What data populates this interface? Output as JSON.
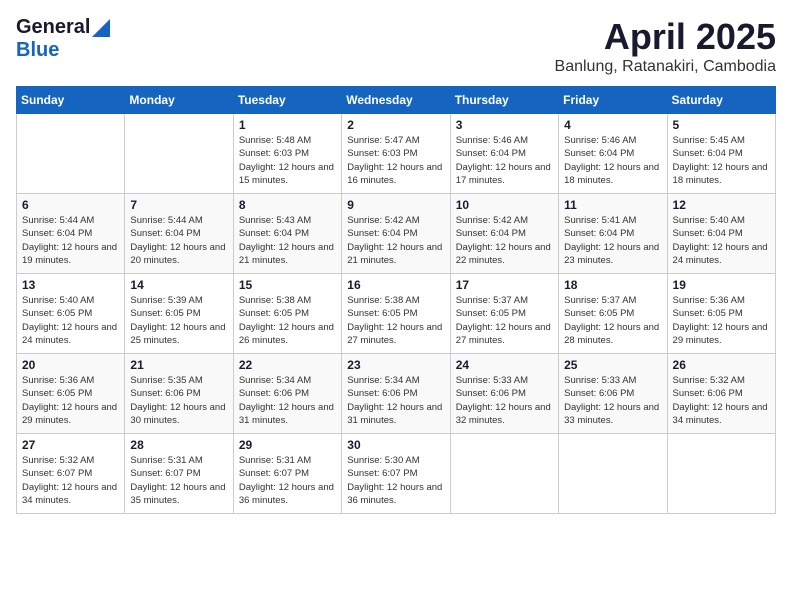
{
  "logo": {
    "general": "General",
    "blue": "Blue"
  },
  "title": {
    "month": "April 2025",
    "location": "Banlung, Ratanakiri, Cambodia"
  },
  "weekdays": [
    "Sunday",
    "Monday",
    "Tuesday",
    "Wednesday",
    "Thursday",
    "Friday",
    "Saturday"
  ],
  "weeks": [
    [
      {
        "day": "",
        "info": ""
      },
      {
        "day": "",
        "info": ""
      },
      {
        "day": "1",
        "info": "Sunrise: 5:48 AM\nSunset: 6:03 PM\nDaylight: 12 hours and 15 minutes."
      },
      {
        "day": "2",
        "info": "Sunrise: 5:47 AM\nSunset: 6:03 PM\nDaylight: 12 hours and 16 minutes."
      },
      {
        "day": "3",
        "info": "Sunrise: 5:46 AM\nSunset: 6:04 PM\nDaylight: 12 hours and 17 minutes."
      },
      {
        "day": "4",
        "info": "Sunrise: 5:46 AM\nSunset: 6:04 PM\nDaylight: 12 hours and 18 minutes."
      },
      {
        "day": "5",
        "info": "Sunrise: 5:45 AM\nSunset: 6:04 PM\nDaylight: 12 hours and 18 minutes."
      }
    ],
    [
      {
        "day": "6",
        "info": "Sunrise: 5:44 AM\nSunset: 6:04 PM\nDaylight: 12 hours and 19 minutes."
      },
      {
        "day": "7",
        "info": "Sunrise: 5:44 AM\nSunset: 6:04 PM\nDaylight: 12 hours and 20 minutes."
      },
      {
        "day": "8",
        "info": "Sunrise: 5:43 AM\nSunset: 6:04 PM\nDaylight: 12 hours and 21 minutes."
      },
      {
        "day": "9",
        "info": "Sunrise: 5:42 AM\nSunset: 6:04 PM\nDaylight: 12 hours and 21 minutes."
      },
      {
        "day": "10",
        "info": "Sunrise: 5:42 AM\nSunset: 6:04 PM\nDaylight: 12 hours and 22 minutes."
      },
      {
        "day": "11",
        "info": "Sunrise: 5:41 AM\nSunset: 6:04 PM\nDaylight: 12 hours and 23 minutes."
      },
      {
        "day": "12",
        "info": "Sunrise: 5:40 AM\nSunset: 6:04 PM\nDaylight: 12 hours and 24 minutes."
      }
    ],
    [
      {
        "day": "13",
        "info": "Sunrise: 5:40 AM\nSunset: 6:05 PM\nDaylight: 12 hours and 24 minutes."
      },
      {
        "day": "14",
        "info": "Sunrise: 5:39 AM\nSunset: 6:05 PM\nDaylight: 12 hours and 25 minutes."
      },
      {
        "day": "15",
        "info": "Sunrise: 5:38 AM\nSunset: 6:05 PM\nDaylight: 12 hours and 26 minutes."
      },
      {
        "day": "16",
        "info": "Sunrise: 5:38 AM\nSunset: 6:05 PM\nDaylight: 12 hours and 27 minutes."
      },
      {
        "day": "17",
        "info": "Sunrise: 5:37 AM\nSunset: 6:05 PM\nDaylight: 12 hours and 27 minutes."
      },
      {
        "day": "18",
        "info": "Sunrise: 5:37 AM\nSunset: 6:05 PM\nDaylight: 12 hours and 28 minutes."
      },
      {
        "day": "19",
        "info": "Sunrise: 5:36 AM\nSunset: 6:05 PM\nDaylight: 12 hours and 29 minutes."
      }
    ],
    [
      {
        "day": "20",
        "info": "Sunrise: 5:36 AM\nSunset: 6:05 PM\nDaylight: 12 hours and 29 minutes."
      },
      {
        "day": "21",
        "info": "Sunrise: 5:35 AM\nSunset: 6:06 PM\nDaylight: 12 hours and 30 minutes."
      },
      {
        "day": "22",
        "info": "Sunrise: 5:34 AM\nSunset: 6:06 PM\nDaylight: 12 hours and 31 minutes."
      },
      {
        "day": "23",
        "info": "Sunrise: 5:34 AM\nSunset: 6:06 PM\nDaylight: 12 hours and 31 minutes."
      },
      {
        "day": "24",
        "info": "Sunrise: 5:33 AM\nSunset: 6:06 PM\nDaylight: 12 hours and 32 minutes."
      },
      {
        "day": "25",
        "info": "Sunrise: 5:33 AM\nSunset: 6:06 PM\nDaylight: 12 hours and 33 minutes."
      },
      {
        "day": "26",
        "info": "Sunrise: 5:32 AM\nSunset: 6:06 PM\nDaylight: 12 hours and 34 minutes."
      }
    ],
    [
      {
        "day": "27",
        "info": "Sunrise: 5:32 AM\nSunset: 6:07 PM\nDaylight: 12 hours and 34 minutes."
      },
      {
        "day": "28",
        "info": "Sunrise: 5:31 AM\nSunset: 6:07 PM\nDaylight: 12 hours and 35 minutes."
      },
      {
        "day": "29",
        "info": "Sunrise: 5:31 AM\nSunset: 6:07 PM\nDaylight: 12 hours and 36 minutes."
      },
      {
        "day": "30",
        "info": "Sunrise: 5:30 AM\nSunset: 6:07 PM\nDaylight: 12 hours and 36 minutes."
      },
      {
        "day": "",
        "info": ""
      },
      {
        "day": "",
        "info": ""
      },
      {
        "day": "",
        "info": ""
      }
    ]
  ]
}
